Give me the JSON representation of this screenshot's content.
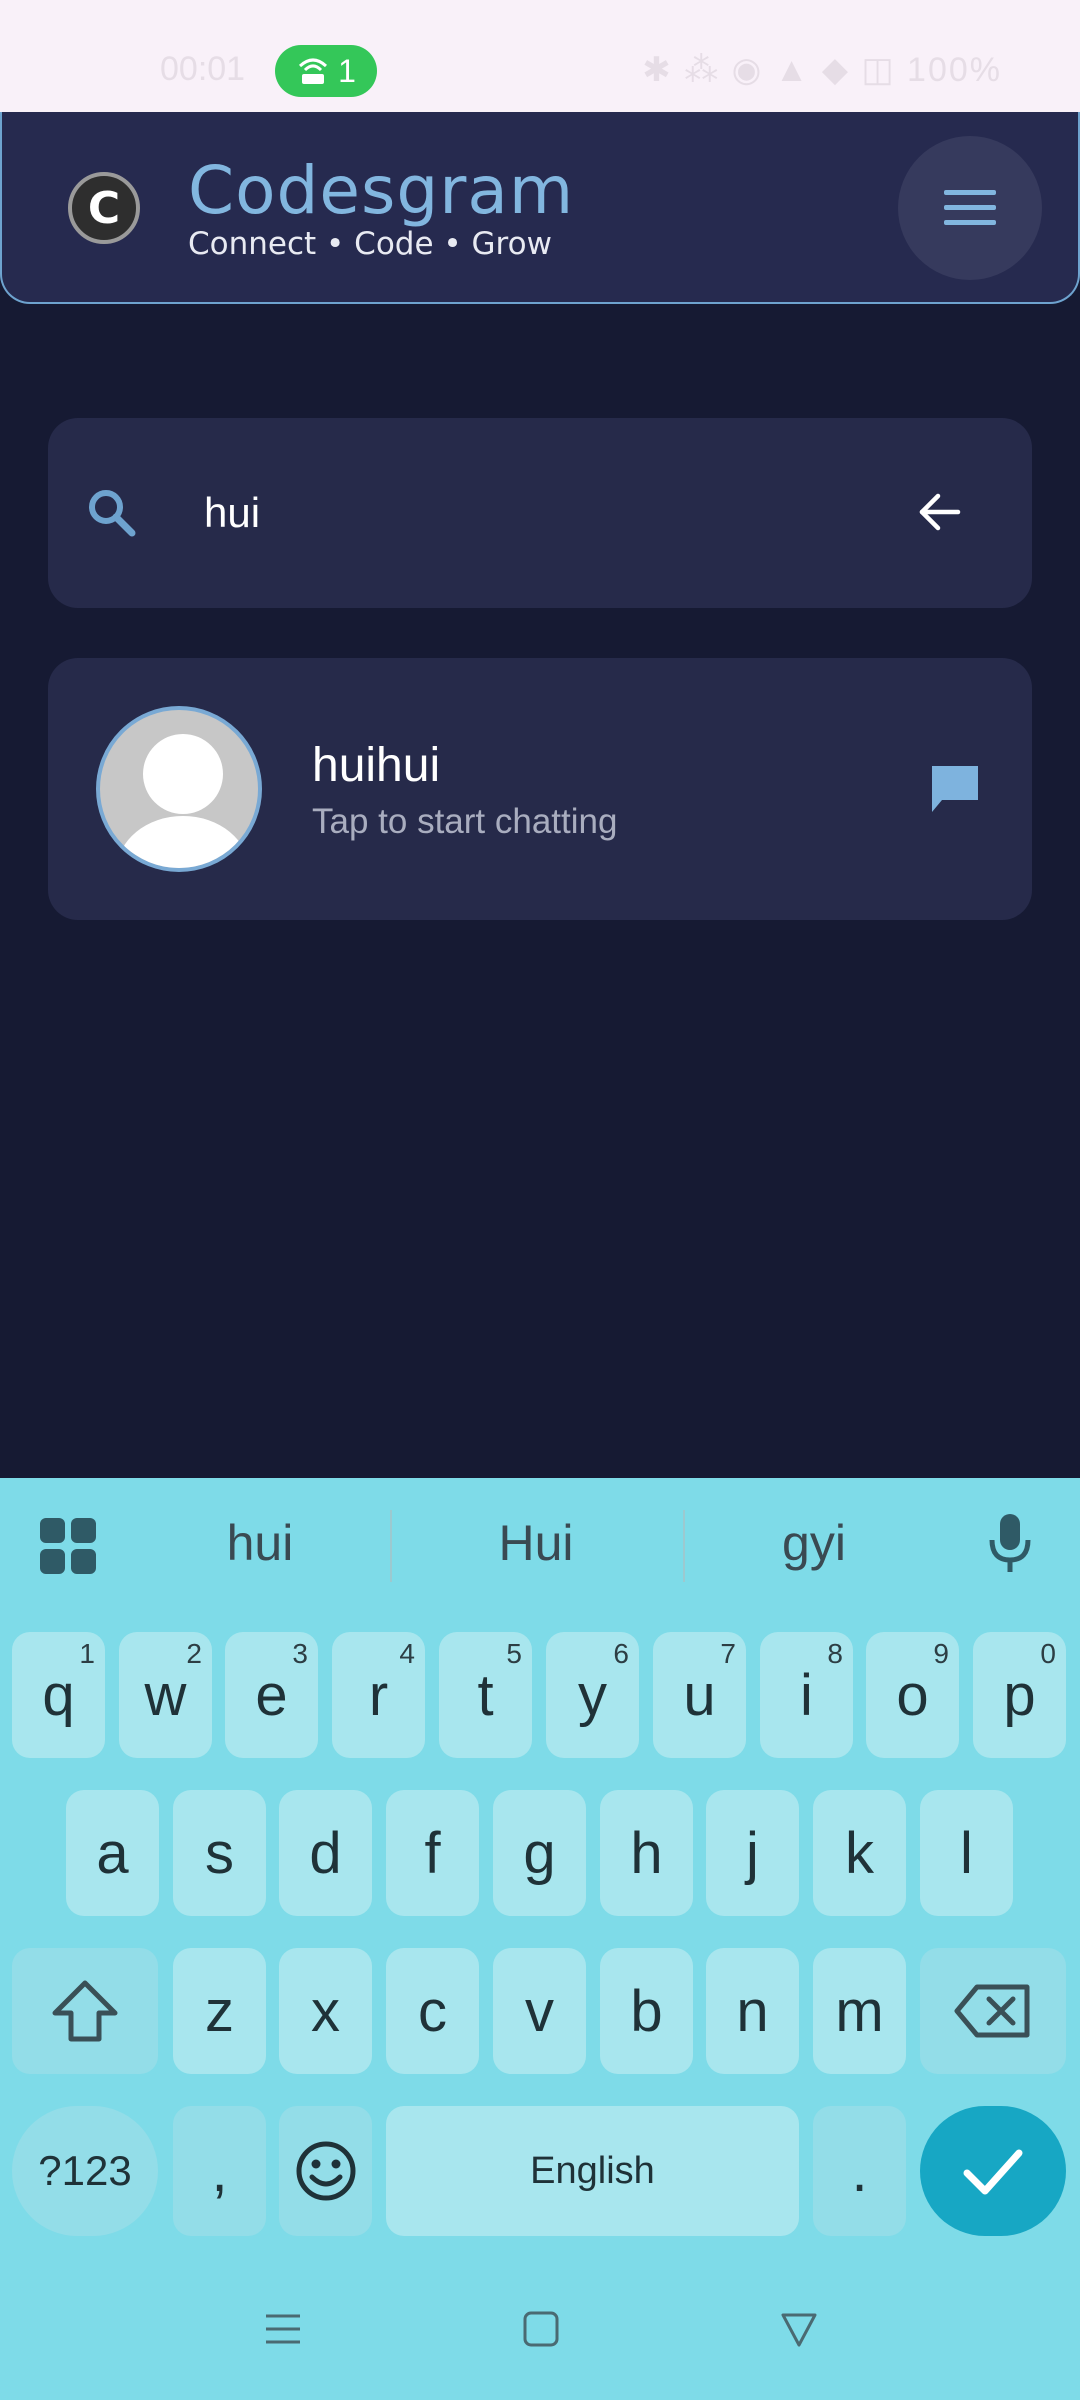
{
  "status": {
    "time": "00:01",
    "hotspot_count": "1",
    "right_icons": "✱ ⁂ ◉ ▲ ◆ ◫ 100%"
  },
  "header": {
    "title": "Codesgram",
    "subtitle": "Connect • Code • Grow",
    "logo_letter": "C"
  },
  "search": {
    "value": "hui",
    "placeholder": ""
  },
  "results": [
    {
      "name": "huihui",
      "hint": "Tap to start chatting"
    }
  ],
  "keyboard": {
    "suggestions": [
      "hui",
      "Hui",
      "gyi"
    ],
    "row1": [
      {
        "k": "q",
        "n": "1"
      },
      {
        "k": "w",
        "n": "2"
      },
      {
        "k": "e",
        "n": "3"
      },
      {
        "k": "r",
        "n": "4"
      },
      {
        "k": "t",
        "n": "5"
      },
      {
        "k": "y",
        "n": "6"
      },
      {
        "k": "u",
        "n": "7"
      },
      {
        "k": "i",
        "n": "8"
      },
      {
        "k": "o",
        "n": "9"
      },
      {
        "k": "p",
        "n": "0"
      }
    ],
    "row2": [
      "a",
      "s",
      "d",
      "f",
      "g",
      "h",
      "j",
      "k",
      "l"
    ],
    "row3": [
      "z",
      "x",
      "c",
      "v",
      "b",
      "n",
      "m"
    ],
    "symbols_label": "?123",
    "comma": ",",
    "space_label": "English",
    "period": "."
  },
  "colors": {
    "accent": "#82b6df",
    "keyboard_bg": "#7edbe8",
    "enter": "#17a7c4",
    "bg": "#161a33"
  }
}
